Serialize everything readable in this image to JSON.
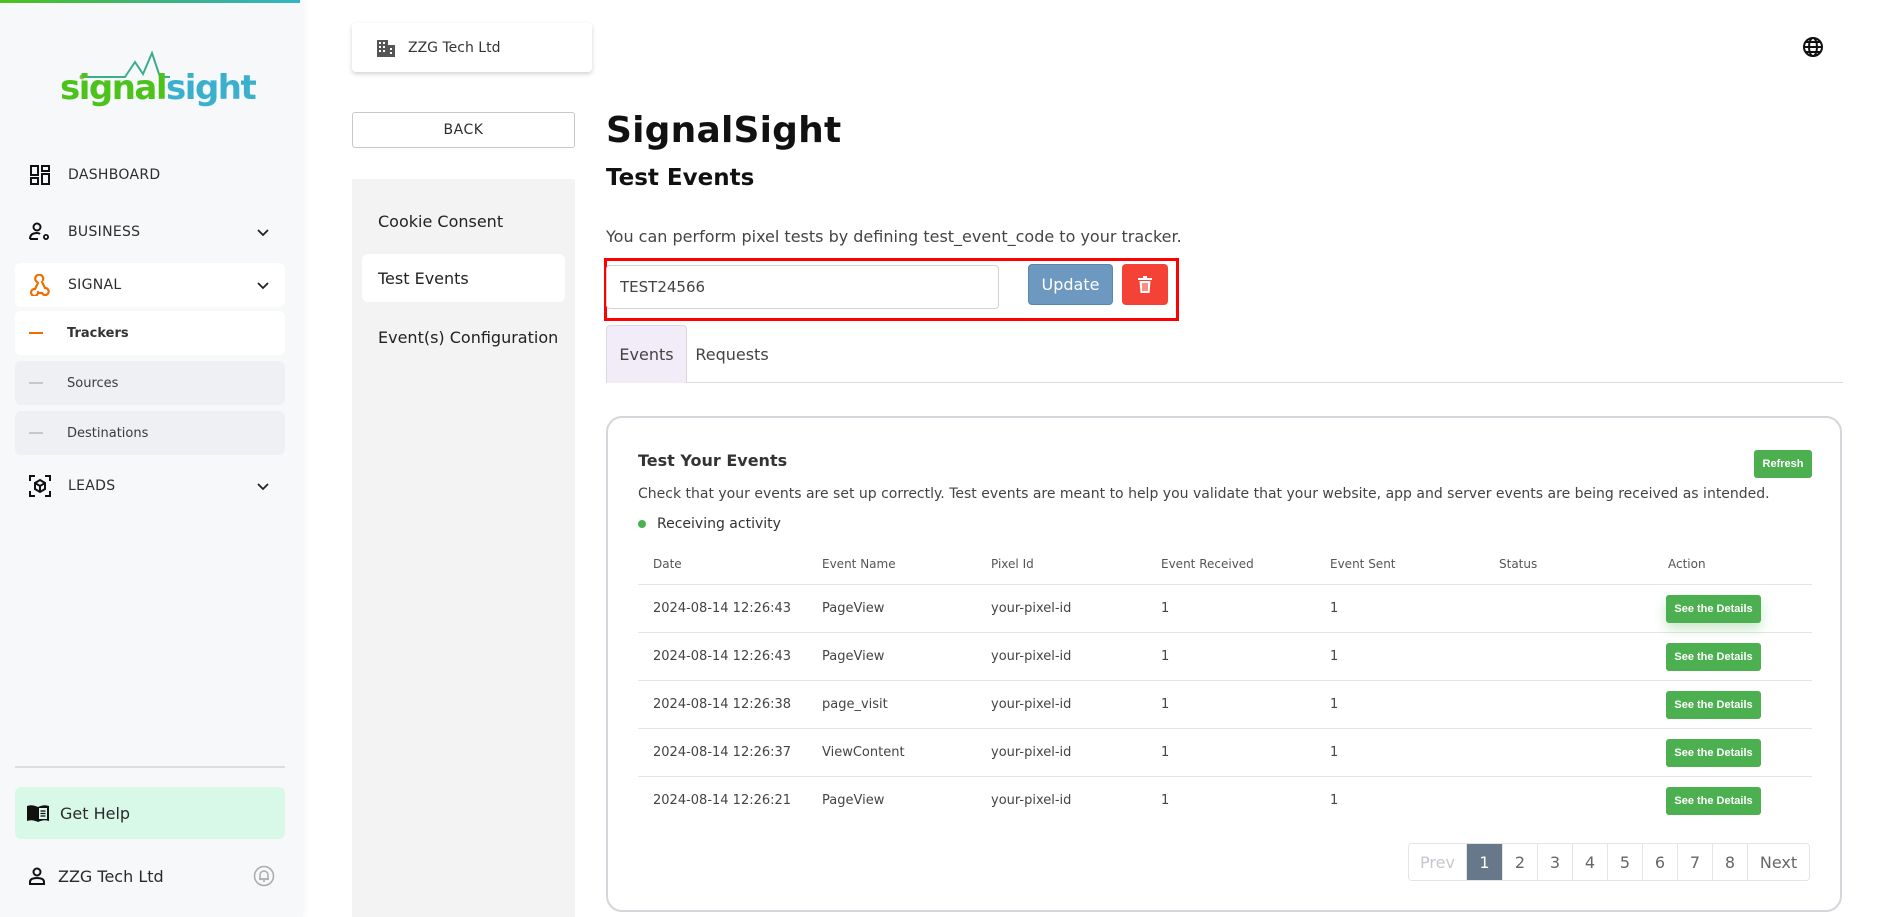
{
  "brand": {
    "logo_part1": "signal",
    "logo_part2": "sight",
    "colors": {
      "green": "#4cc21c",
      "teal": "#3ab0cc",
      "accent_orange": "#ef6c00"
    }
  },
  "sidebar": {
    "items": [
      {
        "label": "DASHBOARD",
        "icon": "dashboard-icon"
      },
      {
        "label": "BUSINESS",
        "icon": "business-settings-icon",
        "expandable": true
      },
      {
        "label": "SIGNAL",
        "icon": "webhook-icon",
        "expandable": true,
        "active": true
      },
      {
        "label": "LEADS",
        "icon": "cube-scan-icon",
        "expandable": true
      }
    ],
    "signal_subitems": [
      {
        "label": "Trackers",
        "active": true
      },
      {
        "label": "Sources"
      },
      {
        "label": "Destinations"
      }
    ],
    "help_label": "Get Help",
    "user_name": "ZZG Tech Ltd"
  },
  "secondary": {
    "company": "ZZG Tech Ltd",
    "back_label": "BACK",
    "nav": [
      {
        "label": "Cookie Consent"
      },
      {
        "label": "Test Events",
        "active": true
      },
      {
        "label": "Event(s) Configuration"
      }
    ]
  },
  "main": {
    "title": "SignalSight",
    "subtitle": "Test Events",
    "intro": "You can perform pixel tests by defining test_event_code to your tracker.",
    "test_code_value": "TEST24566",
    "update_label": "Update",
    "tabs": [
      {
        "label": "Events",
        "active": true
      },
      {
        "label": "Requests"
      }
    ],
    "card": {
      "title": "Test Your Events",
      "refresh_label": "Refresh",
      "description": "Check that your events are set up correctly. Test events are meant to help you validate that your website, app and server events are being received as intended.",
      "status": "Receiving activity",
      "columns": [
        "Date",
        "Event Name",
        "Pixel Id",
        "Event Received",
        "Event Sent",
        "Status",
        "Action"
      ],
      "rows": [
        {
          "date": "2024-08-14 12:26:43",
          "event": "PageView",
          "pixel": "your-pixel-id",
          "received": "1",
          "sent": "1",
          "status": "",
          "action": "See the Details"
        },
        {
          "date": "2024-08-14 12:26:43",
          "event": "PageView",
          "pixel": "your-pixel-id",
          "received": "1",
          "sent": "1",
          "status": "",
          "action": "See the Details"
        },
        {
          "date": "2024-08-14 12:26:38",
          "event": "page_visit",
          "pixel": "your-pixel-id",
          "received": "1",
          "sent": "1",
          "status": "",
          "action": "See the Details"
        },
        {
          "date": "2024-08-14 12:26:37",
          "event": "ViewContent",
          "pixel": "your-pixel-id",
          "received": "1",
          "sent": "1",
          "status": "",
          "action": "See the Details"
        },
        {
          "date": "2024-08-14 12:26:21",
          "event": "PageView",
          "pixel": "your-pixel-id",
          "received": "1",
          "sent": "1",
          "status": "",
          "action": "See the Details"
        }
      ],
      "pagination": {
        "prev": "Prev",
        "pages": [
          "1",
          "2",
          "3",
          "4",
          "5",
          "6",
          "7",
          "8"
        ],
        "current": "1",
        "next": "Next"
      }
    }
  }
}
